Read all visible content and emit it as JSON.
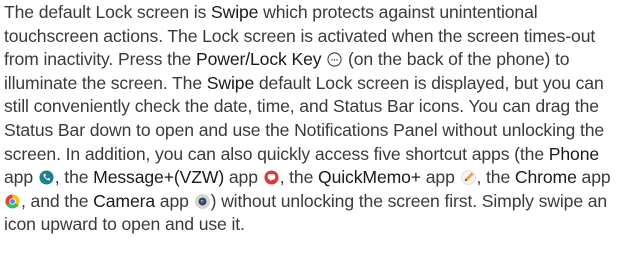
{
  "paragraph": {
    "s1_pre": "The default Lock screen is ",
    "swipe_1": "Swipe",
    "s1_post": " which protects against unintentional touchscreen actions. The Lock screen is activated when the screen times-out from inactivity. Press the ",
    "power_key": "Power/Lock Key",
    "s2_post": " (on the back of the phone) to illuminate the screen. The ",
    "swipe_2": "Swipe",
    "s3_post": " default Lock screen is displayed, but you can still conveniently check the date, time, and Status Bar icons. You can drag the Status Bar down to open and use the Notifications Panel without unlocking the screen. In addition, you can also quickly access five shortcut apps (the ",
    "phone": "Phone",
    "t_app_1": " app ",
    "t_sep_1": ", the ",
    "message": "Message+(VZW)",
    "t_app_2": " app ",
    "t_sep_2": ", the ",
    "quickmemo": "QuickMemo+",
    "t_app_3": " app ",
    "t_sep_3": ", the ",
    "chrome": "Chrome",
    "t_app_4": " app ",
    "t_sep_4": ", and the ",
    "camera": "Camera",
    "t_app_5": " app ",
    "s_end": ") without unlocking the screen first. Simply swipe an icon upward to open and use it."
  },
  "icons": {
    "power_key": "power-key-icon",
    "phone": "phone-app-icon",
    "message": "message-app-icon",
    "quickmemo": "quickmemo-app-icon",
    "chrome": "chrome-app-icon",
    "camera": "camera-app-icon"
  },
  "colors": {
    "text": "#3a3a3a",
    "emphasis": "#1a1a1a",
    "phone_icon": "#1f7f8a",
    "message_icon": "#e2352b",
    "quickmemo_icon": "#e8a33c",
    "chrome_icon": "#db4437",
    "camera_icon": "#3d3d3d"
  }
}
